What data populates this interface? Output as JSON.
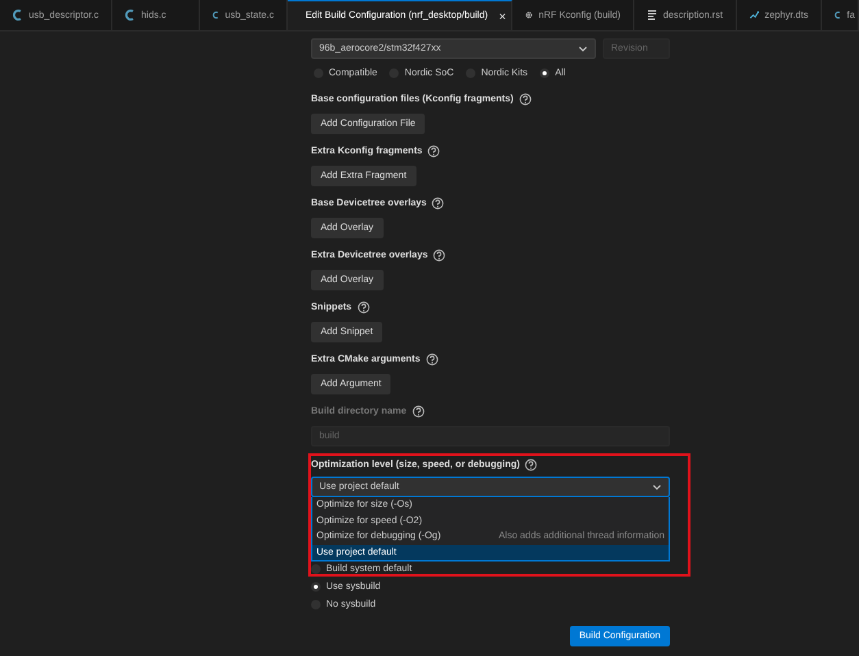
{
  "tabs": [
    {
      "label": "usb_descriptor.c",
      "kind": "c",
      "selected": false
    },
    {
      "label": "hids.c",
      "kind": "c",
      "selected": false
    },
    {
      "label": "usb_state.c",
      "kind": "c",
      "selected": false
    },
    {
      "label": "Edit Build Configuration (nrf_desktop/build)",
      "kind": "form",
      "selected": true,
      "close": "×"
    },
    {
      "label": "nRF Kconfig (build)",
      "kind": "gear",
      "selected": false
    },
    {
      "label": "description.rst",
      "kind": "doc",
      "selected": false
    },
    {
      "label": "zephyr.dts",
      "kind": "dts",
      "selected": false
    },
    {
      "label": "fa",
      "kind": "c",
      "selected": false
    }
  ],
  "board": {
    "value": "96b_aerocore2/stm32f427xx",
    "revision": {
      "placeholder": "Revision",
      "disabled": true
    }
  },
  "board_filters": [
    {
      "label": "Compatible",
      "selected": false
    },
    {
      "label": "Nordic SoC",
      "selected": false
    },
    {
      "label": "Nordic Kits",
      "selected": false
    },
    {
      "label": "All",
      "selected": true
    }
  ],
  "sections": [
    {
      "label": "Base configuration files (Kconfig fragments)",
      "button": "Add Configuration File"
    },
    {
      "label": "Extra Kconfig fragments",
      "button": "Add Extra Fragment"
    },
    {
      "label": "Base Devicetree overlays",
      "button": "Add Overlay"
    },
    {
      "label": "Extra Devicetree overlays",
      "button": "Add Overlay"
    },
    {
      "label": "Snippets",
      "button": "Add Snippet"
    },
    {
      "label": "Extra CMake arguments",
      "button": "Add Argument"
    }
  ],
  "build_directory": {
    "label": "Build directory name",
    "placeholder": "build",
    "disabled": true
  },
  "optimization": {
    "label": "Optimization level (size, speed, or debugging)",
    "value": "Use project default",
    "expanded": true,
    "options": [
      {
        "label": "Optimize for size (-Os)",
        "selected": false
      },
      {
        "label": "Optimize for speed (-O2)",
        "selected": false
      },
      {
        "label": "Optimize for debugging (-Og)",
        "note": "Also adds additional thread information",
        "selected": false
      },
      {
        "label": "Use project default",
        "selected": true
      }
    ]
  },
  "sysbuild_options": [
    {
      "label": "Build system default",
      "selected": false
    },
    {
      "label": "Use sysbuild",
      "selected": true
    },
    {
      "label": "No sysbuild",
      "selected": false
    }
  ],
  "build_button": "Build Configuration"
}
